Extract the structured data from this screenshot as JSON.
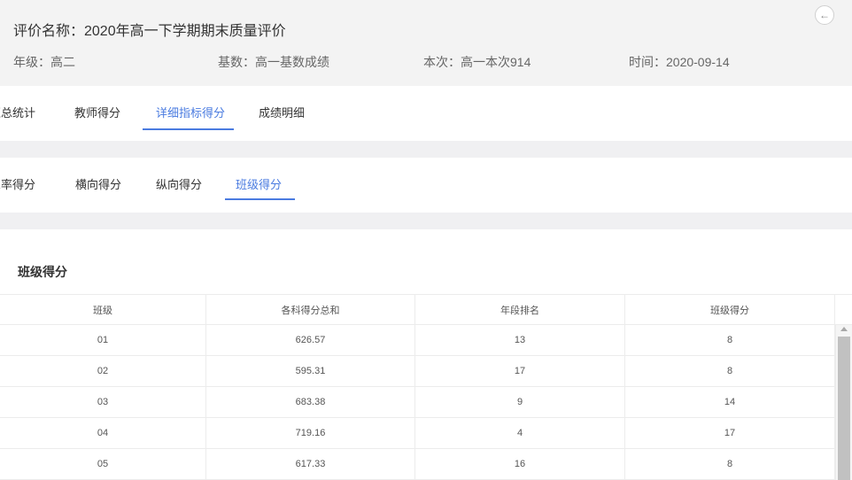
{
  "header": {
    "evaluation_title": "评价名称：2020年高一下学期期末质量评价",
    "grade": "年级：高二",
    "base": "基数：高一基数成绩",
    "current": "本次：高一本次914",
    "time": "时间：2020-09-14",
    "back_icon": "arrow-left-icon"
  },
  "main_tabs": [
    {
      "label": "汇总统计",
      "active": false
    },
    {
      "label": "教师得分",
      "active": false
    },
    {
      "label": "详细指标得分",
      "active": true
    },
    {
      "label": "成绩明细",
      "active": false
    }
  ],
  "sub_tabs": [
    {
      "label": "三率得分",
      "active": false
    },
    {
      "label": "横向得分",
      "active": false
    },
    {
      "label": "纵向得分",
      "active": false
    },
    {
      "label": "班级得分",
      "active": true
    }
  ],
  "section": {
    "title": "班级得分"
  },
  "table": {
    "columns": [
      "班级",
      "各科得分总和",
      "年段排名",
      "班级得分"
    ],
    "rows": [
      [
        "01",
        "626.57",
        "13",
        "8"
      ],
      [
        "02",
        "595.31",
        "17",
        "8"
      ],
      [
        "03",
        "683.38",
        "9",
        "14"
      ],
      [
        "04",
        "719.16",
        "4",
        "17"
      ],
      [
        "05",
        "617.33",
        "16",
        "8"
      ]
    ]
  },
  "colors": {
    "accent": "#4a7be0",
    "header_bg": "#f3f3f3",
    "separator": "#f0f0f2"
  }
}
